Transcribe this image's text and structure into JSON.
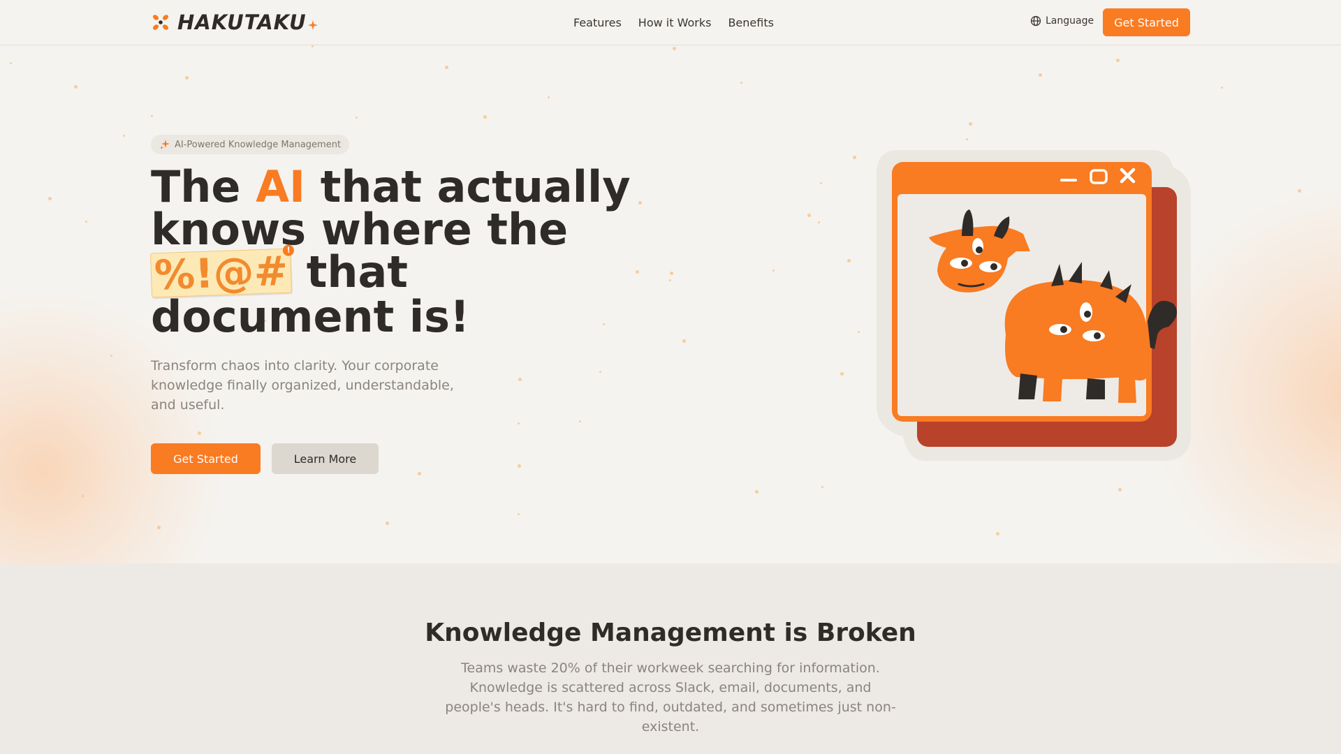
{
  "brand": {
    "name": "HAKUTAKU",
    "accent_color": "#f97b22"
  },
  "nav": {
    "links": [
      "Features",
      "How it Works",
      "Benefits"
    ],
    "language_label": "Language",
    "language_icon": "globe-icon",
    "cta_label": "Get Started"
  },
  "hero": {
    "badge_icon": "sparkle-icon",
    "badge_text": "AI-Powered Knowledge Management",
    "headline": {
      "part1": "The ",
      "highlight": "AI",
      "part2": " that actually knows where the ",
      "censored": "%!@#",
      "censored_badge": "!",
      "part3": " that document is!"
    },
    "subtitle": "Transform chaos into clarity. Your corporate knowledge finally organized, understandable, and useful.",
    "primary_button": "Get Started",
    "secondary_button": "Learn More",
    "illustration": "window-with-cow-mascot"
  },
  "problem_section": {
    "title": "Knowledge Management is Broken",
    "text": "Teams waste 20% of their workweek searching for information. Knowledge is scattered across Slack, email, documents, and people's heads. It's hard to find, outdated, and sometimes just non-existent."
  }
}
